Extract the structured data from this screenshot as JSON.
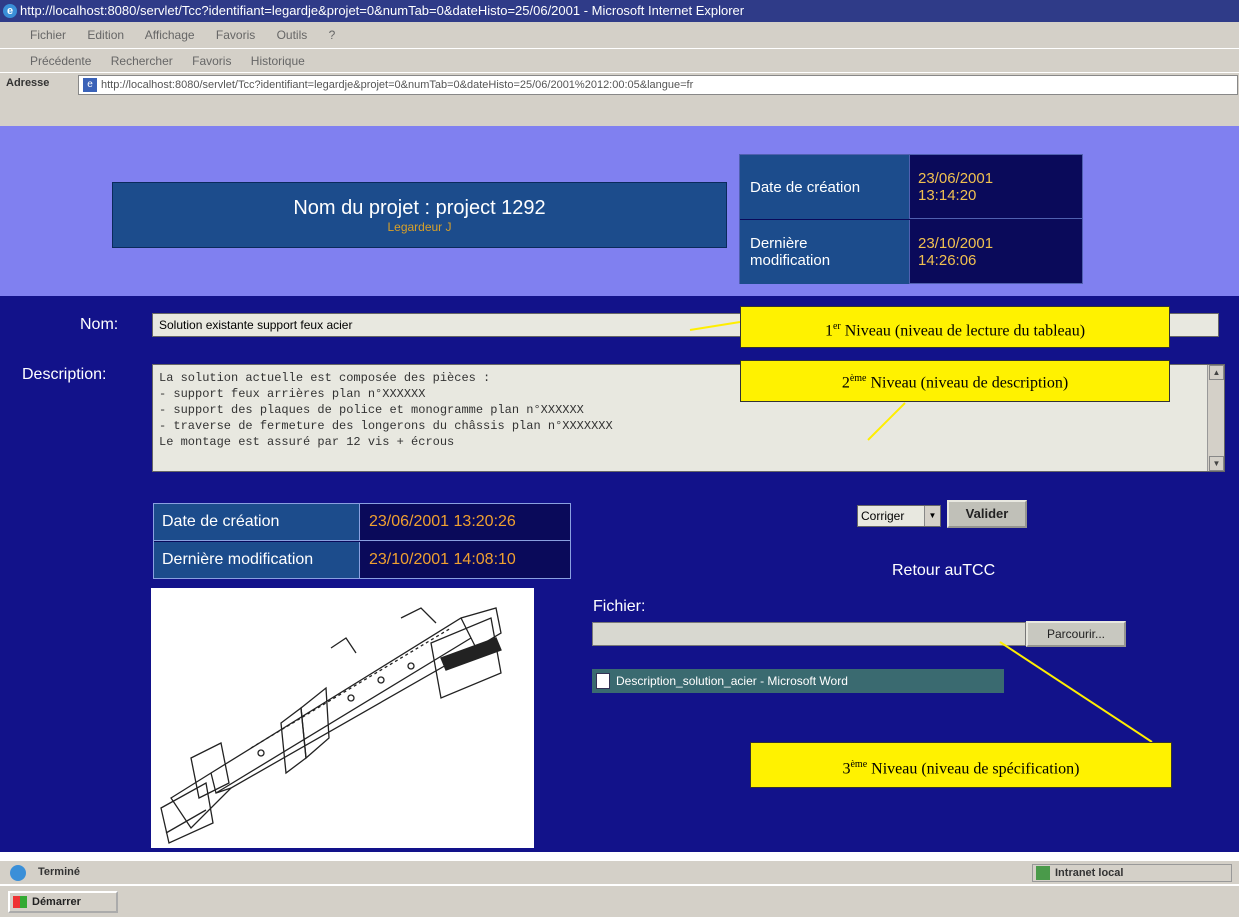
{
  "window": {
    "title": "http://localhost:8080/servlet/Tcc?identifiant=legardje&projet=0&numTab=0&dateHisto=25/06/2001 - Microsoft Internet Explorer"
  },
  "menu": [
    "Fichier",
    "Edition",
    "Affichage",
    "Favoris",
    "Outils",
    "?"
  ],
  "toolbar": [
    "Précédente",
    "Rechercher",
    "Favoris",
    "Historique"
  ],
  "address": {
    "label": "Adresse",
    "url": "http://localhost:8080/servlet/Tcc?identifiant=legardje&projet=0&numTab=0&dateHisto=25/06/2001%2012:00:05&langue=fr"
  },
  "project": {
    "name": "Nom du projet : project 1292",
    "author": "Legardeur J"
  },
  "project_dates": {
    "created_label": "Date de création",
    "created_value": "23/06/2001\n13:14:20",
    "modified_label": "Dernière\nmodification",
    "modified_value": "23/10/2001\n14:26:06"
  },
  "form": {
    "nom_label": "Nom:",
    "nom_value": "Solution existante support feux acier",
    "description_label": "Description:",
    "description_value": "La solution actuelle est composée des pièces :\n- support feux arrières plan n°XXXXXX\n- support des plaques de police et monogramme plan n°XXXXXX\n- traverse de fermeture des longerons du châssis plan n°XXXXXXX\nLe montage est assuré par 12 vis + écrous"
  },
  "element_dates": {
    "created_label": "Date de création",
    "created_value": "23/06/2001 13:20:26",
    "modified_label": "Dernière modification",
    "modified_value": "23/10/2001 14:08:10"
  },
  "actions": {
    "select_value": "Corriger",
    "validate_label": "Valider",
    "back_link": "Retour auTCC"
  },
  "file": {
    "label": "Fichier:",
    "browse_label": "Parcourir...",
    "document_link": "Description_solution_acier - Microsoft Word"
  },
  "callouts": {
    "level1_num": "1",
    "level1_sup": "er",
    "level1_text": " Niveau (niveau de lecture du tableau)",
    "level2_num": "2",
    "level2_sup": "ème",
    "level2_text": " Niveau (niveau de description)",
    "level3_num": "3",
    "level3_sup": "ème",
    "level3_text": " Niveau (niveau de spécification)",
    "color": "#fff200"
  },
  "status": {
    "text": "Terminé",
    "zone": "Intranet local"
  },
  "taskbar": {
    "start": "Démarrer"
  },
  "colors": {
    "header_bg": "#8080f0",
    "main_bg": "#12128a",
    "panel_bg": "#1c4c8c",
    "date_value": "#f0c050"
  }
}
